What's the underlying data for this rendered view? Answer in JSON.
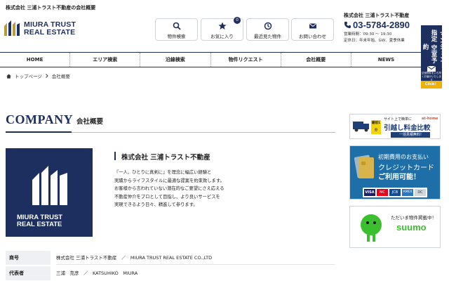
{
  "header": {
    "top_title": "株式会社 三浦トラスト不動産の会社概要",
    "logo_line1": "MIURA TRUST",
    "logo_line2": "REAL ESTATE",
    "buttons": [
      {
        "label": "物件検索",
        "icon": "search-icon"
      },
      {
        "label": "お気に入り",
        "icon": "star-icon",
        "badge": "0"
      },
      {
        "label": "最近見た物件",
        "icon": "history-icon"
      },
      {
        "label": "お問い合わせ",
        "icon": "mail-icon"
      }
    ],
    "company_name": "株式会社 三浦トラスト不動産",
    "tel": "03-5784-2890",
    "hours": "営業時間：09:30 〜 19:30",
    "holidays": "定休日：年末年始、GW、夏季休業",
    "mansion_label": "マンション指定 空室予約",
    "mansion_small": "空室物件をいち早くお届けいたします",
    "mansion_click": "Click！"
  },
  "nav": [
    "HOME",
    "エリア検索",
    "沿線検索",
    "物件リクエスト",
    "会社概要",
    "NEWS"
  ],
  "breadcrumb": {
    "home": "トップページ",
    "current": "会社概要"
  },
  "company": {
    "heading_en": "COMPANY",
    "heading_jp": "会社概要",
    "logo_line1": "MIURA TRUST",
    "logo_line2": "REAL ESTATE",
    "name": "株式会社 三浦トラスト不動産",
    "description": [
      "『一人、ひとりに真剣に』を理念に幅広い経験と",
      "実績からライフスタイルに最適な提案を約束致します。",
      "お客様から言われていない潜在的なご要望にさえ応える",
      "不動産仲介をプロとして目指し、より良いサービスを",
      "実現できるよう日々、精進して参ります。"
    ],
    "table": [
      {
        "label": "商号",
        "value": "株式会社 三浦トラスト不動産　／　MIURA TRUST REAL ESTATE CO.,LTD"
      },
      {
        "label": "代表者",
        "value": "三浦　克彦　／　KATSUHIKO　MIURA"
      }
    ]
  },
  "sidebar": {
    "banner1_top": "サイト上で簡単に",
    "banner1_main": "引越し料金比較",
    "banner1_brand": "at-home",
    "banner1_sub": "一括見積無料!",
    "banner1_badge": "最短1分",
    "banner2_line1": "初期費用のお支払い",
    "banner2_line2": "クレジットカード",
    "banner2_line3": "ご利用可能！",
    "banner2_cards": [
      "VISA",
      "MC",
      "JCB",
      "AMEX",
      "DC"
    ],
    "banner3_line1": "ただいま物件掲載中！",
    "banner3_brand": "suumo"
  }
}
